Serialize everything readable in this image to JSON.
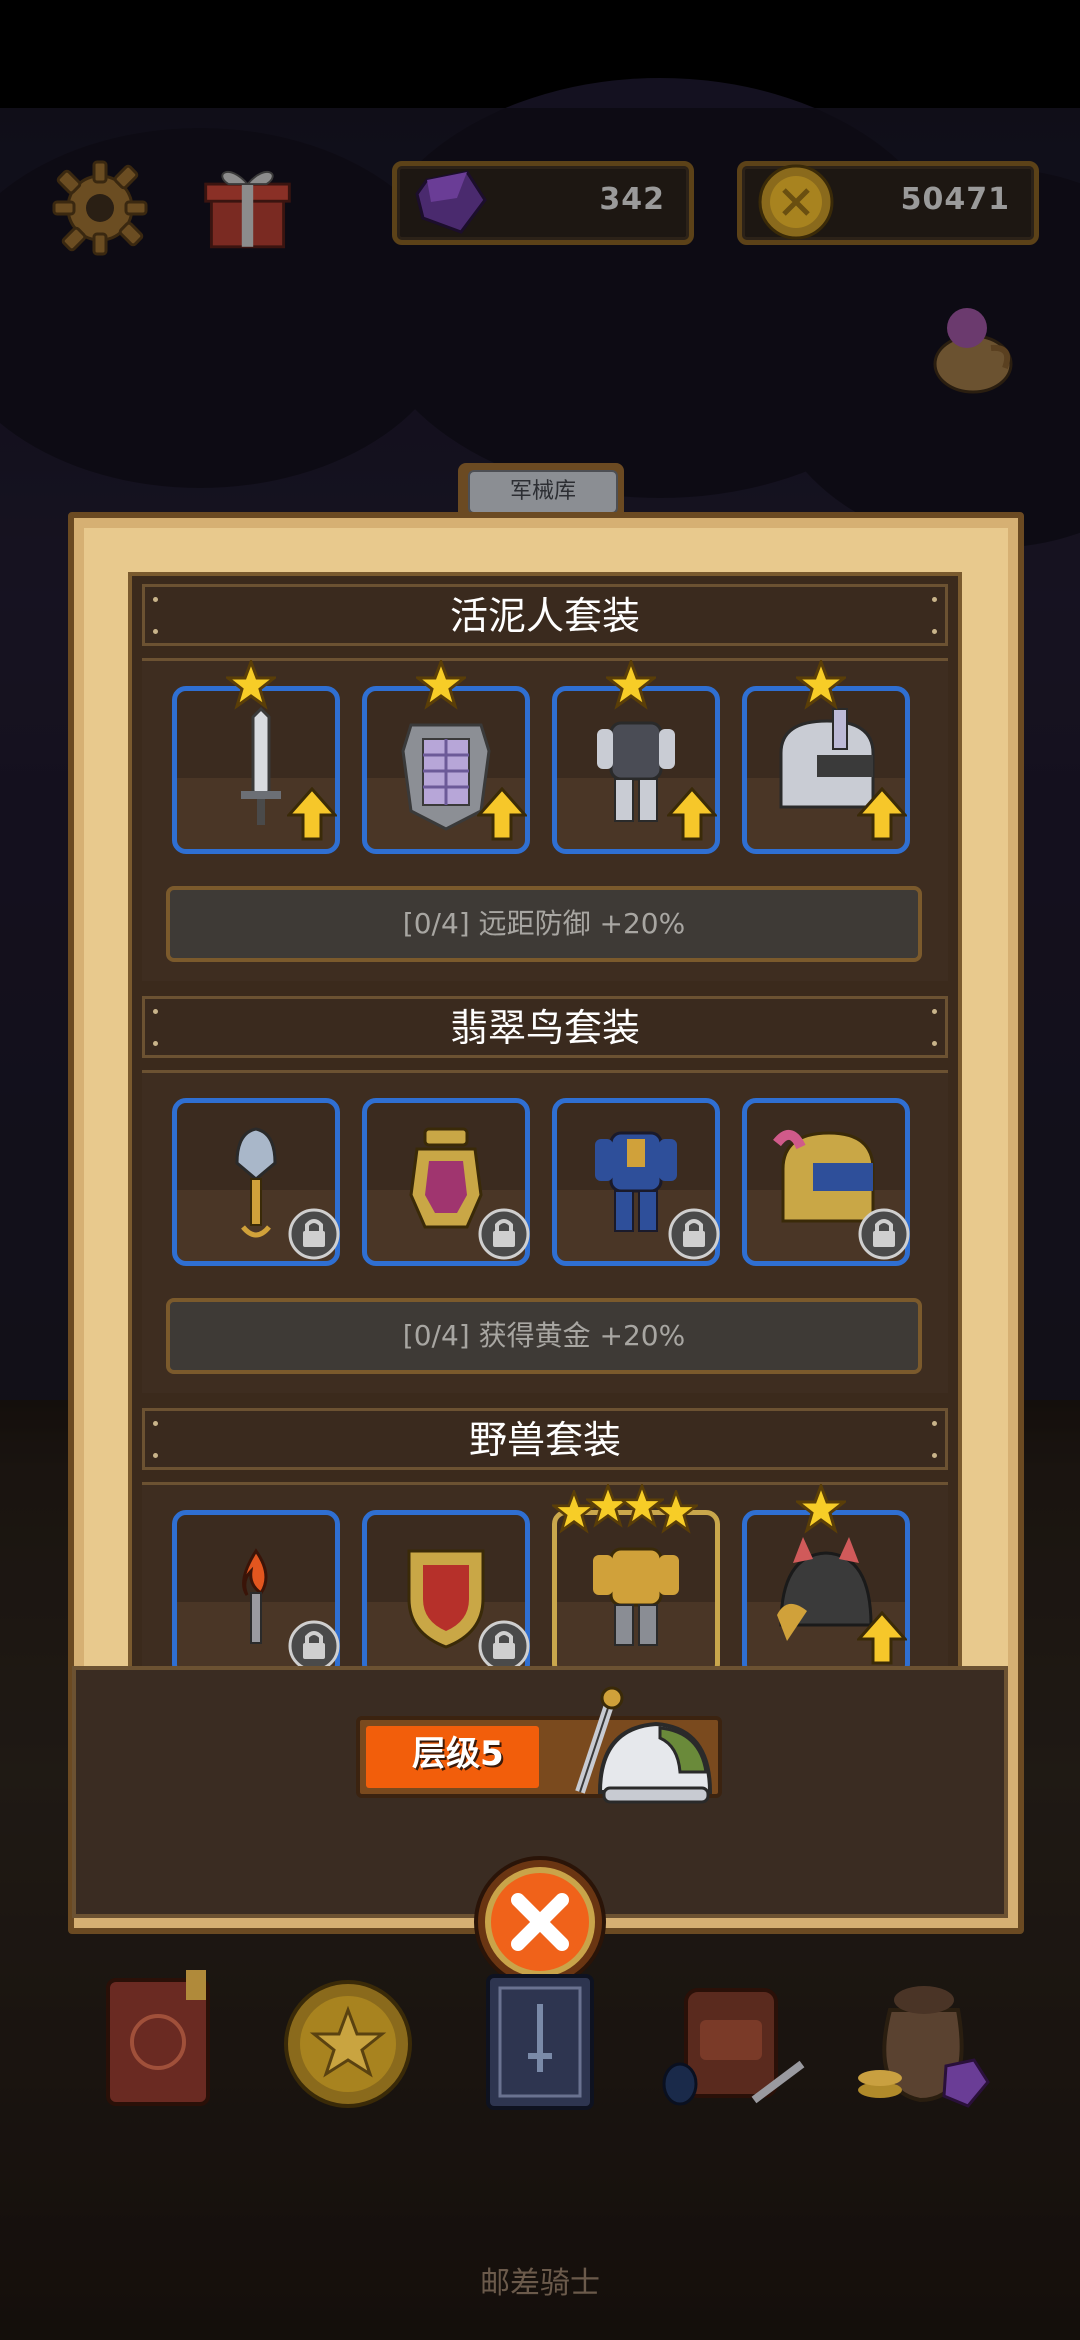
{
  "hud": {
    "gems": "342",
    "gold": "50471",
    "settings_icon": "gear-icon",
    "gift_icon": "gift-icon",
    "pouch_icon": "pouch-icon"
  },
  "panel": {
    "tab_label": "军械库",
    "sets": [
      {
        "name": "活泥人套装",
        "bonus": "[0/4] 远距防御 +20%",
        "items": [
          {
            "icon": "sword-icon",
            "stars": 1,
            "state": "upgrade"
          },
          {
            "icon": "shield-icon",
            "stars": 1,
            "state": "upgrade"
          },
          {
            "icon": "armor-icon",
            "stars": 1,
            "state": "upgrade"
          },
          {
            "icon": "helmet-icon",
            "stars": 1,
            "state": "upgrade"
          }
        ]
      },
      {
        "name": "翡翠鸟套装",
        "bonus": "[0/4] 获得黄金 +20%",
        "items": [
          {
            "icon": "mace-icon",
            "stars": 0,
            "state": "locked"
          },
          {
            "icon": "lantern-shield-icon",
            "stars": 0,
            "state": "locked"
          },
          {
            "icon": "armor-icon",
            "stars": 0,
            "state": "locked"
          },
          {
            "icon": "helmet-icon",
            "stars": 0,
            "state": "locked"
          }
        ]
      },
      {
        "name": "野兽套装",
        "items": [
          {
            "icon": "torch-icon",
            "stars": 0,
            "state": "locked"
          },
          {
            "icon": "shield-icon",
            "stars": 0,
            "state": "locked"
          },
          {
            "icon": "armor-icon",
            "stars": 4,
            "state": "max"
          },
          {
            "icon": "helmet-icon",
            "stars": 1,
            "state": "upgrade"
          }
        ]
      }
    ],
    "level_label": "层级5",
    "level_progress": 0.5
  },
  "nav": [
    {
      "icon": "book-icon"
    },
    {
      "icon": "star-coin-icon"
    },
    {
      "icon": "spellbook-icon"
    },
    {
      "icon": "backpack-icon"
    },
    {
      "icon": "treasure-bag-icon"
    }
  ],
  "footer": "邮差骑士",
  "colors": {
    "slot_border": "#2f6fd2",
    "slot_border_max": "#c9a74c",
    "level_fill": "#f25e0b",
    "panel_bg": "#e8c98d"
  }
}
